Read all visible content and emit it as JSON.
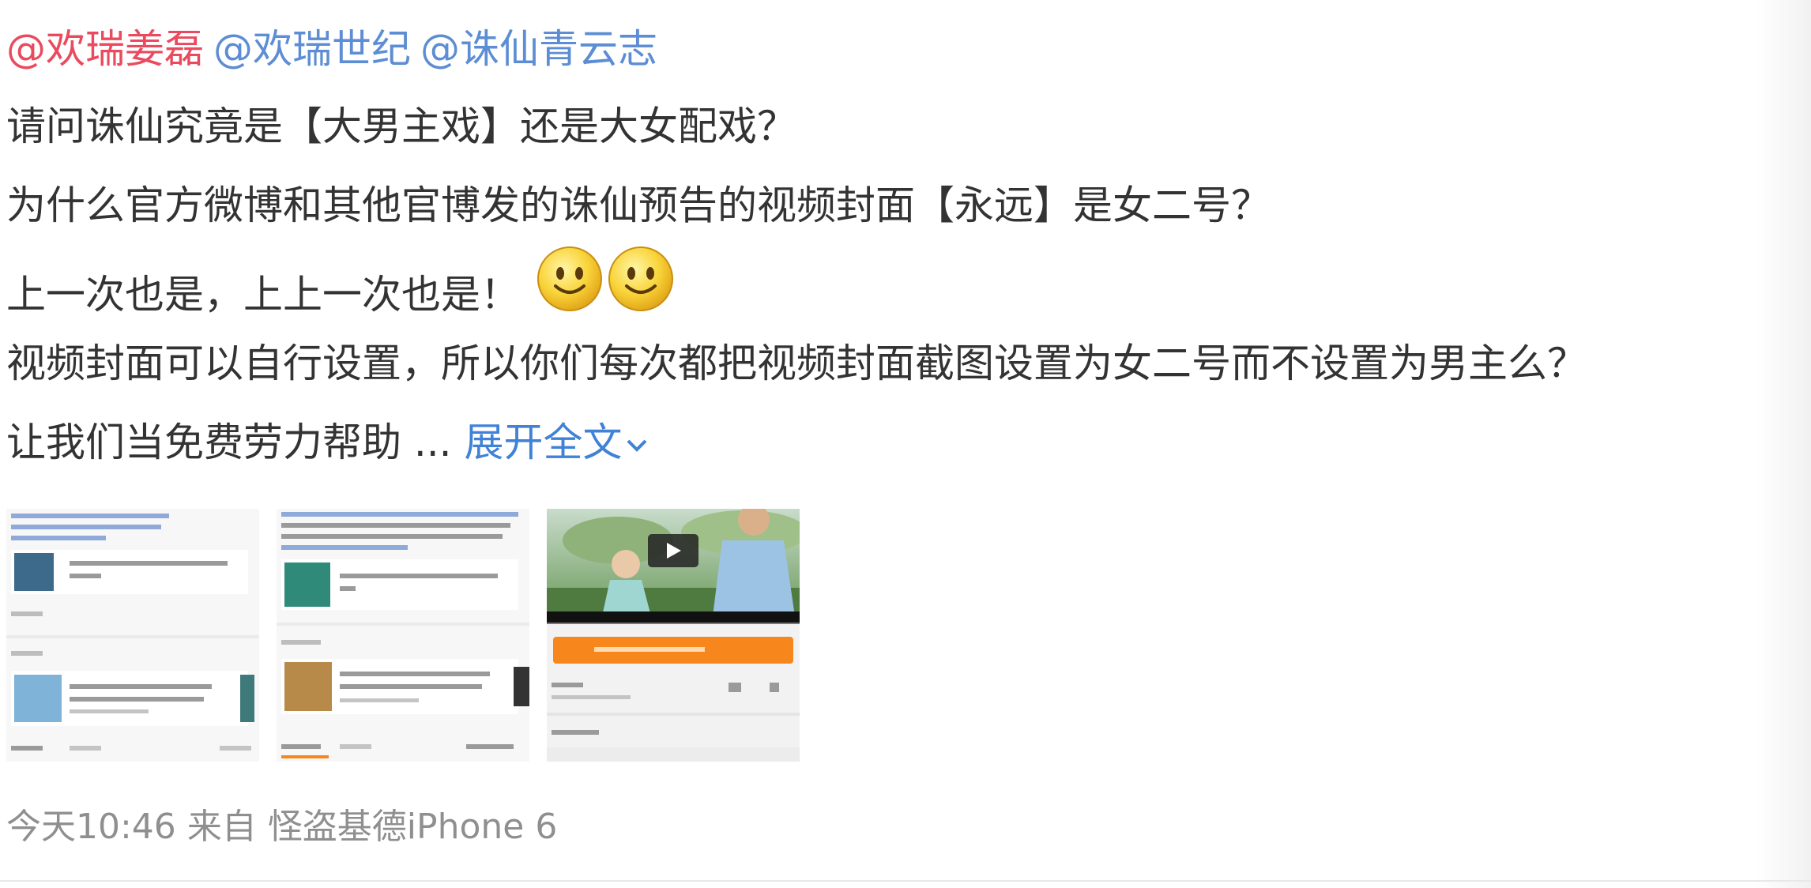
{
  "post": {
    "mentions": [
      "@欢瑞姜磊",
      "@欢瑞世纪",
      "@诛仙青云志"
    ],
    "lines": [
      "请问诛仙究竟是【大男主戏】还是大女配戏？",
      "为什么官方微博和其他官博发的诛仙预告的视频封面【永远】是女二号？",
      "上一次也是，上上一次也是！",
      "视频封面可以自行设置，所以你们每次都把视频封面截图设置为女二号而不设置为男主么？",
      "让我们当免费劳力帮助 ..."
    ],
    "emoji": [
      "smile-emoji",
      "smile-emoji"
    ],
    "expand_label": "展开全文",
    "thumbnails": [
      {
        "kind": "screenshot",
        "icon": "document-screenshot"
      },
      {
        "kind": "screenshot",
        "icon": "document-screenshot"
      },
      {
        "kind": "video-screenshot",
        "icon": "play-icon"
      }
    ]
  },
  "footer": {
    "time": "今天10:46",
    "source_prefix": "来自",
    "source": "怪盗基德iPhone 6"
  },
  "colors": {
    "mention": "#5d8dd4",
    "mention_highlight": "#eb4a5e",
    "link": "#3f82d6",
    "text": "#333333",
    "meta": "#8f8f8f",
    "orange_button": "#f7871c"
  }
}
